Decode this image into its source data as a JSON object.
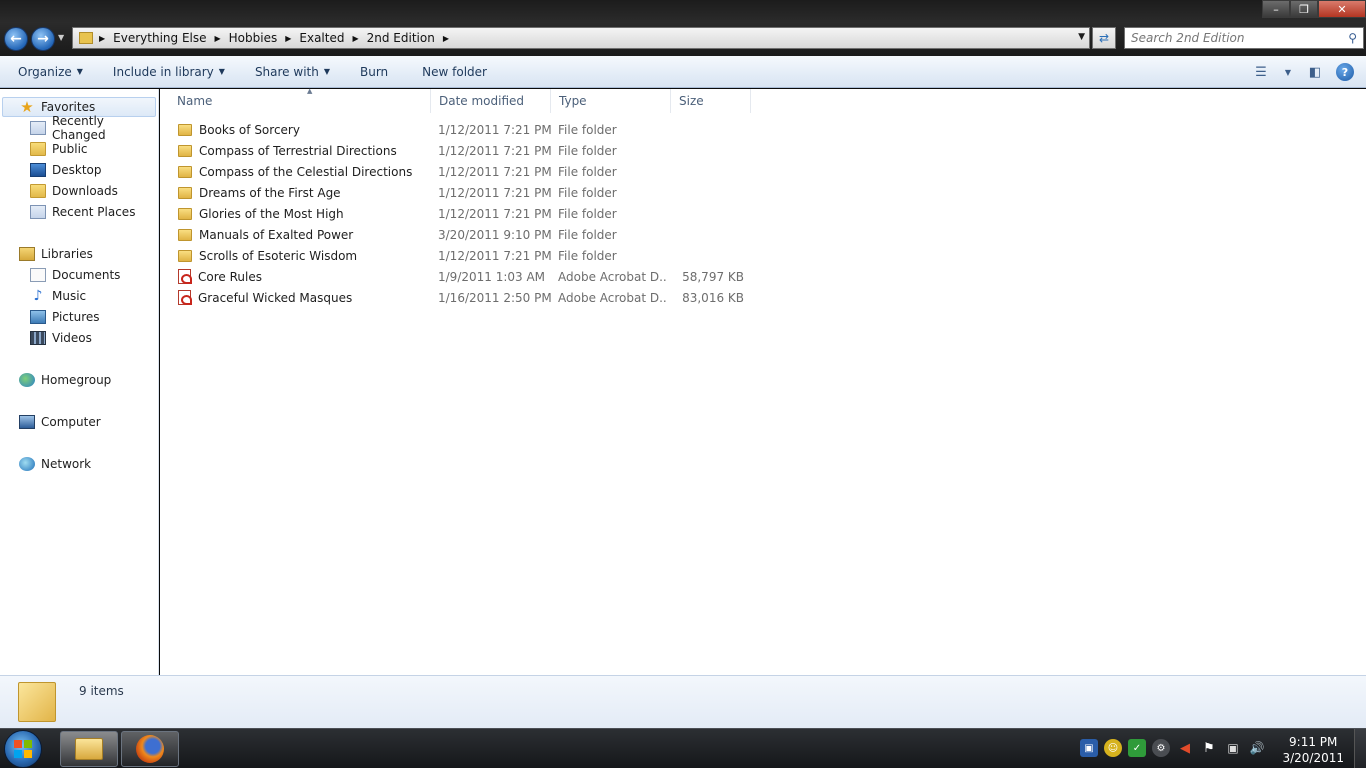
{
  "window": {
    "breadcrumb": [
      "Everything Else",
      "Hobbies",
      "Exalted",
      "2nd Edition"
    ],
    "search_placeholder": "Search 2nd Edition"
  },
  "toolbar": {
    "organize": "Organize",
    "include_in_library": "Include in library",
    "share_with": "Share with",
    "burn": "Burn",
    "new_folder": "New folder"
  },
  "nav": {
    "favorites": "Favorites",
    "recently_changed": "Recently Changed",
    "public": "Public",
    "desktop": "Desktop",
    "downloads": "Downloads",
    "recent_places": "Recent Places",
    "libraries": "Libraries",
    "documents": "Documents",
    "music": "Music",
    "pictures": "Pictures",
    "videos": "Videos",
    "homegroup": "Homegroup",
    "computer": "Computer",
    "network": "Network"
  },
  "columns": {
    "name": "Name",
    "date_modified": "Date modified",
    "type": "Type",
    "size": "Size"
  },
  "files": [
    {
      "name": "Books of Sorcery",
      "date": "1/12/2011 7:21 PM",
      "type": "File folder",
      "size": "",
      "icon": "folder-icon"
    },
    {
      "name": "Compass of Terrestrial Directions",
      "date": "1/12/2011 7:21 PM",
      "type": "File folder",
      "size": "",
      "icon": "folder-icon"
    },
    {
      "name": "Compass of the Celestial Directions",
      "date": "1/12/2011 7:21 PM",
      "type": "File folder",
      "size": "",
      "icon": "folder-icon"
    },
    {
      "name": "Dreams of the First Age",
      "date": "1/12/2011 7:21 PM",
      "type": "File folder",
      "size": "",
      "icon": "folder-icon"
    },
    {
      "name": "Glories of the Most High",
      "date": "1/12/2011 7:21 PM",
      "type": "File folder",
      "size": "",
      "icon": "folder-icon"
    },
    {
      "name": "Manuals of Exalted Power",
      "date": "3/20/2011 9:10 PM",
      "type": "File folder",
      "size": "",
      "icon": "folder-icon"
    },
    {
      "name": "Scrolls of Esoteric Wisdom",
      "date": "1/12/2011 7:21 PM",
      "type": "File folder",
      "size": "",
      "icon": "folder-icon"
    },
    {
      "name": "Core Rules",
      "date": "1/9/2011 1:03 AM",
      "type": "Adobe Acrobat D...",
      "size": "58,797 KB",
      "icon": "pdf-icon"
    },
    {
      "name": "Graceful Wicked Masques",
      "date": "1/16/2011 2:50 PM",
      "type": "Adobe Acrobat D...",
      "size": "83,016 KB",
      "icon": "pdf-icon"
    }
  ],
  "details": {
    "item_count": "9 items"
  },
  "taskbar": {
    "time": "9:11 PM",
    "date": "3/20/2011"
  }
}
